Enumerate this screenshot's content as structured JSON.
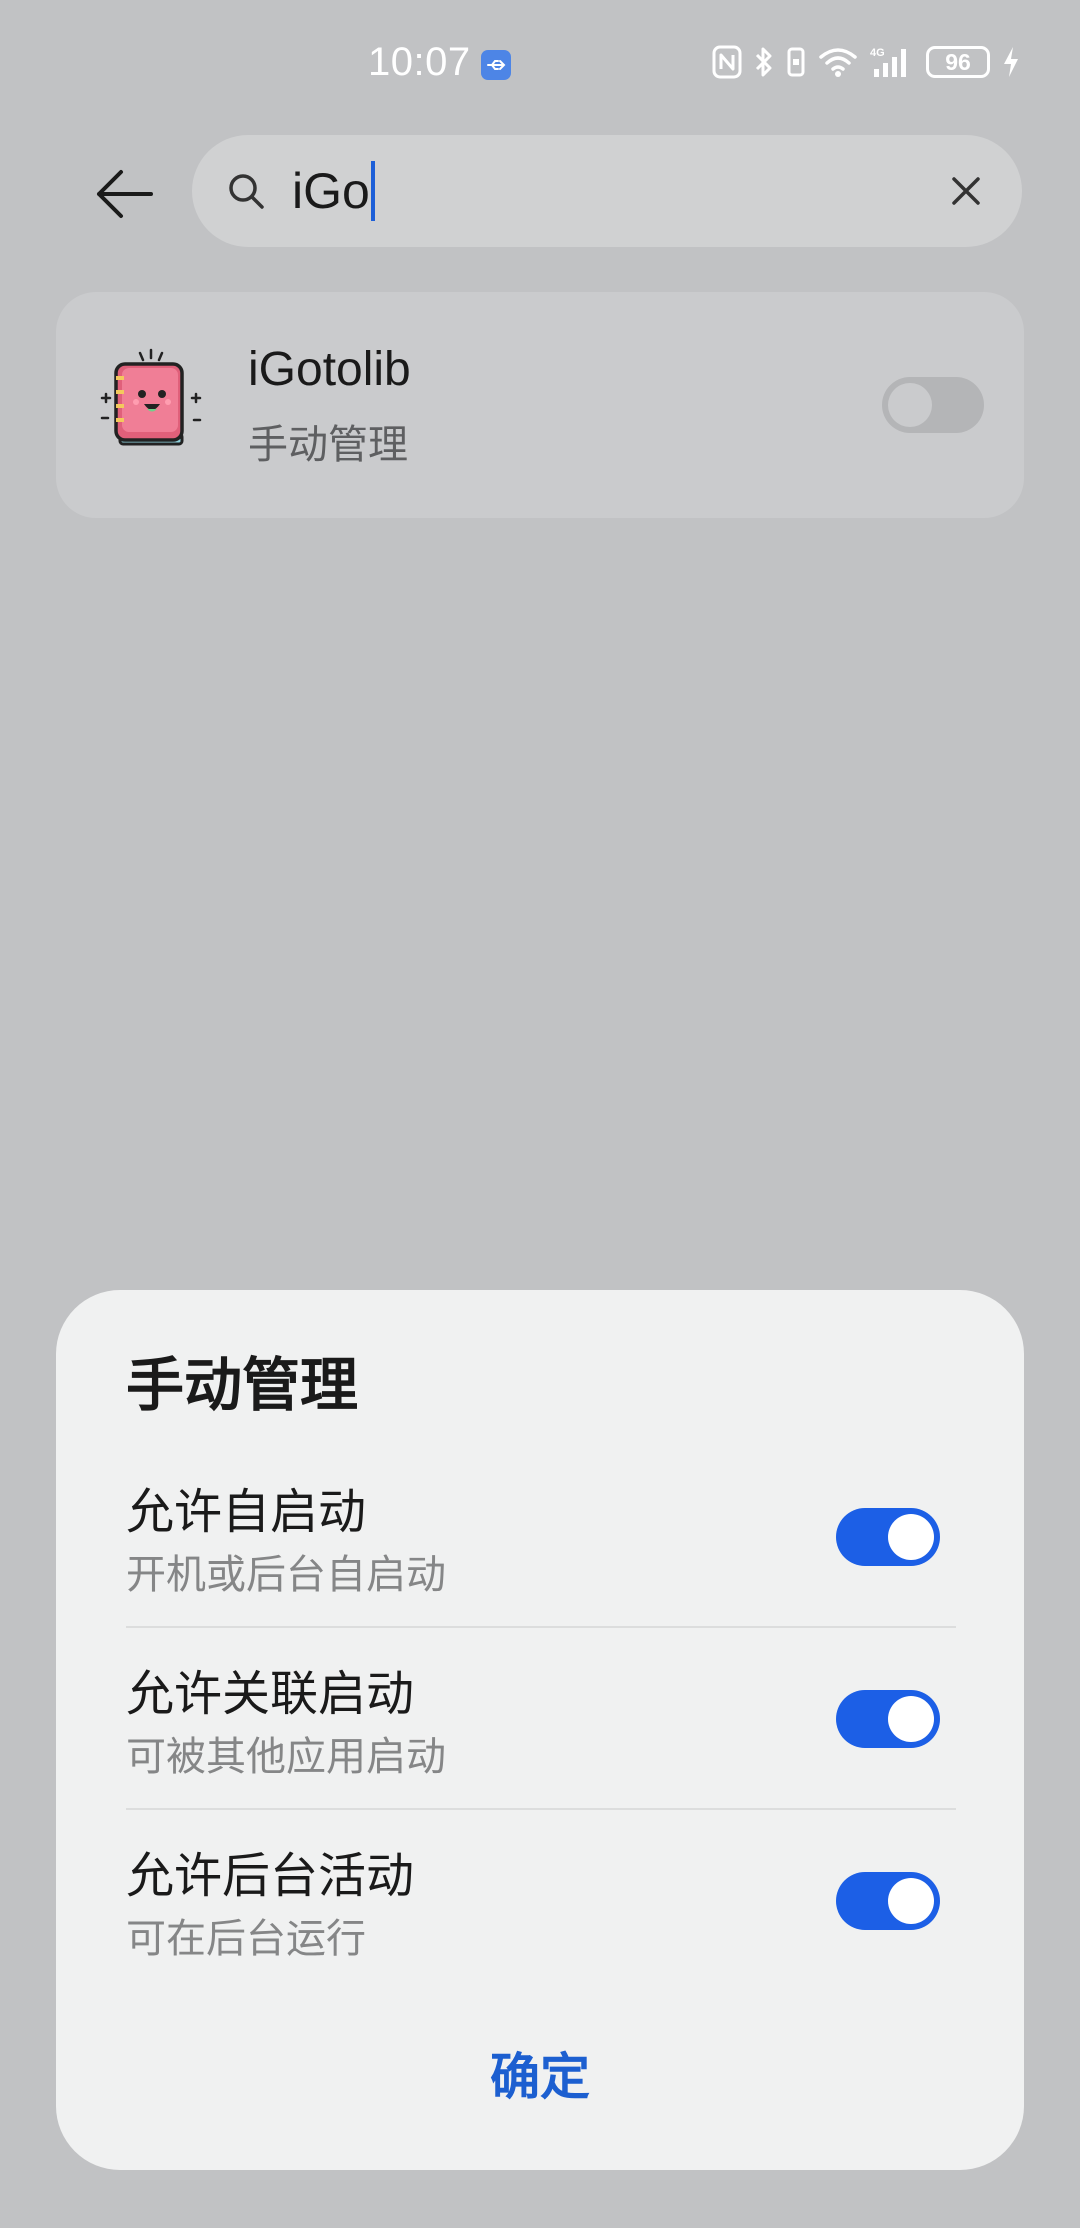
{
  "status_bar": {
    "time": "10:07",
    "battery": "96",
    "icons": [
      "usb-icon",
      "nfc-icon",
      "bluetooth-icon",
      "vibrate-icon",
      "wifi-icon",
      "signal-4g-icon",
      "battery-icon",
      "charging-icon"
    ],
    "network_label": "4G"
  },
  "search": {
    "query": "iGo",
    "icons": [
      "back-arrow-icon",
      "search-icon",
      "clear-icon"
    ]
  },
  "app_list": [
    {
      "name": "iGotolib",
      "subtitle": "手动管理",
      "toggle_on": false,
      "icon": "book-mascot-icon"
    }
  ],
  "dialog": {
    "title": "手动管理",
    "options": [
      {
        "title": "允许自启动",
        "desc": "开机或后台自启动",
        "enabled": true
      },
      {
        "title": "允许关联启动",
        "desc": "可被其他应用启动",
        "enabled": true
      },
      {
        "title": "允许后台活动",
        "desc": "可在后台运行",
        "enabled": true
      }
    ],
    "confirm_label": "确定"
  },
  "colors": {
    "accent": "#1c5fe6",
    "scrim_background": "#c1c2c4",
    "dialog_background": "#f0f1f1"
  }
}
